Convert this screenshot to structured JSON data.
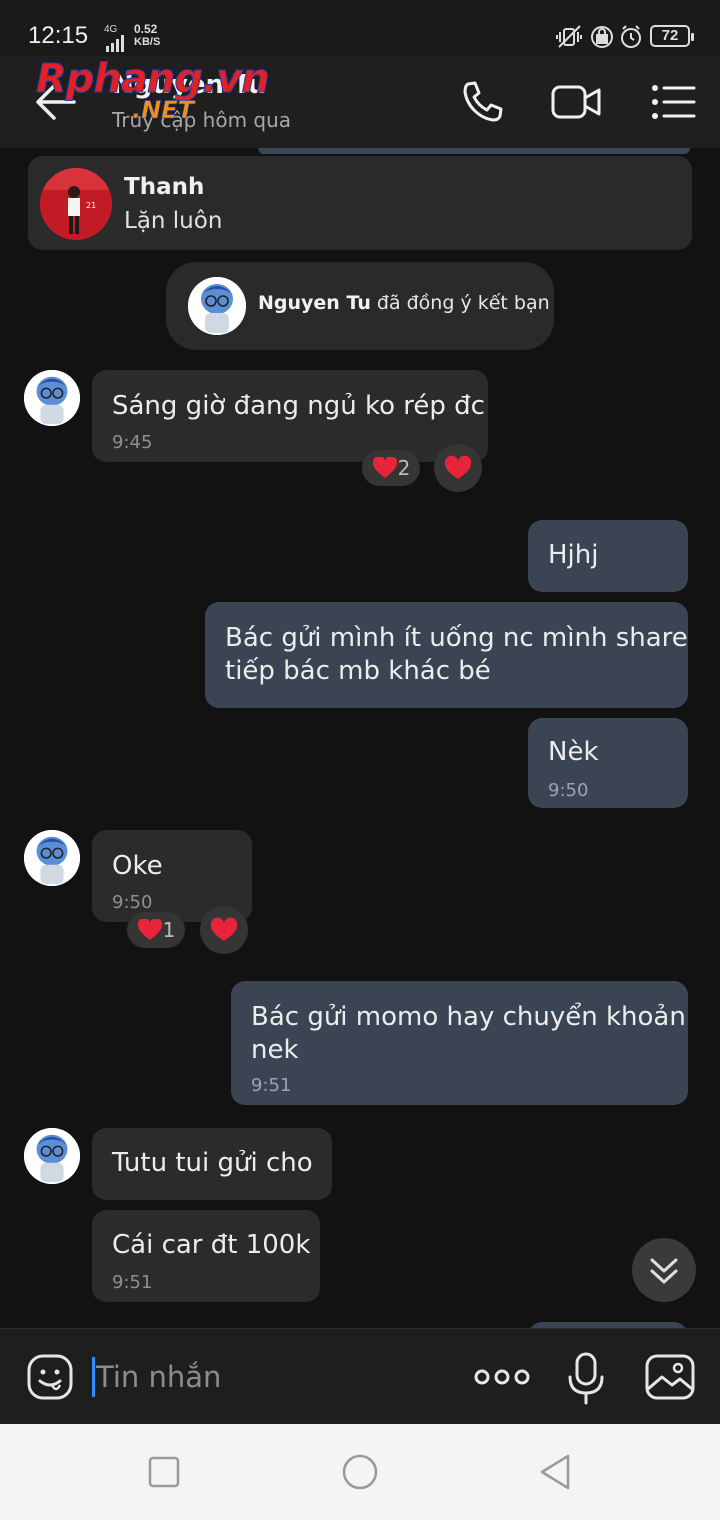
{
  "status_bar": {
    "time": "12:15",
    "network_top": "4G",
    "speed_value": "0.52",
    "speed_unit": "KB/S",
    "battery": "72"
  },
  "header": {
    "contact_name": "Nguyen Tu",
    "presence": "Truy cập hôm qua",
    "watermark_main": "Rphang.vn",
    "watermark_sub": ".NET"
  },
  "pinned": {
    "sender": "Thanh",
    "text": "Lặn luôn"
  },
  "notice": {
    "name": "Nguyen Tu",
    "text": " đã đồng ý kết bạn"
  },
  "messages": {
    "m1": {
      "text": "Sáng giờ đang ngủ ko rép đc",
      "time": "9:45",
      "reaction_count": "2"
    },
    "m2": {
      "text": "Hjhj"
    },
    "m3": {
      "line1": "Bác gửi mình ít uống nc mình share",
      "line2": "tiếp bác mb khác bé"
    },
    "m4": {
      "text": "Nèk",
      "time": "9:50"
    },
    "m5": {
      "text": "Oke",
      "time": "9:50",
      "reaction_count": "1"
    },
    "m6": {
      "line1": "Bác gửi momo hay chuyển khoản",
      "line2": "nek",
      "time": "9:51"
    },
    "m7": {
      "text": "Tutu tui gửi cho"
    },
    "m8": {
      "text": "Cái car đt 100k",
      "time": "9:51"
    }
  },
  "input": {
    "placeholder": "Tin nhắn",
    "value": ""
  },
  "colors": {
    "background": "#121212",
    "incoming_bubble": "#2b2b2b",
    "outgoing_bubble": "#3a4453",
    "heart": "#e8243a",
    "cursor": "#2f8cff"
  },
  "icons": [
    "back-arrow-icon",
    "phone-icon",
    "video-call-icon",
    "menu-list-icon",
    "heart-icon",
    "chevron-double-down-icon",
    "emoji-icon",
    "more-dots-icon",
    "microphone-icon",
    "image-icon",
    "nav-recent-icon",
    "nav-home-icon",
    "nav-back-icon"
  ]
}
